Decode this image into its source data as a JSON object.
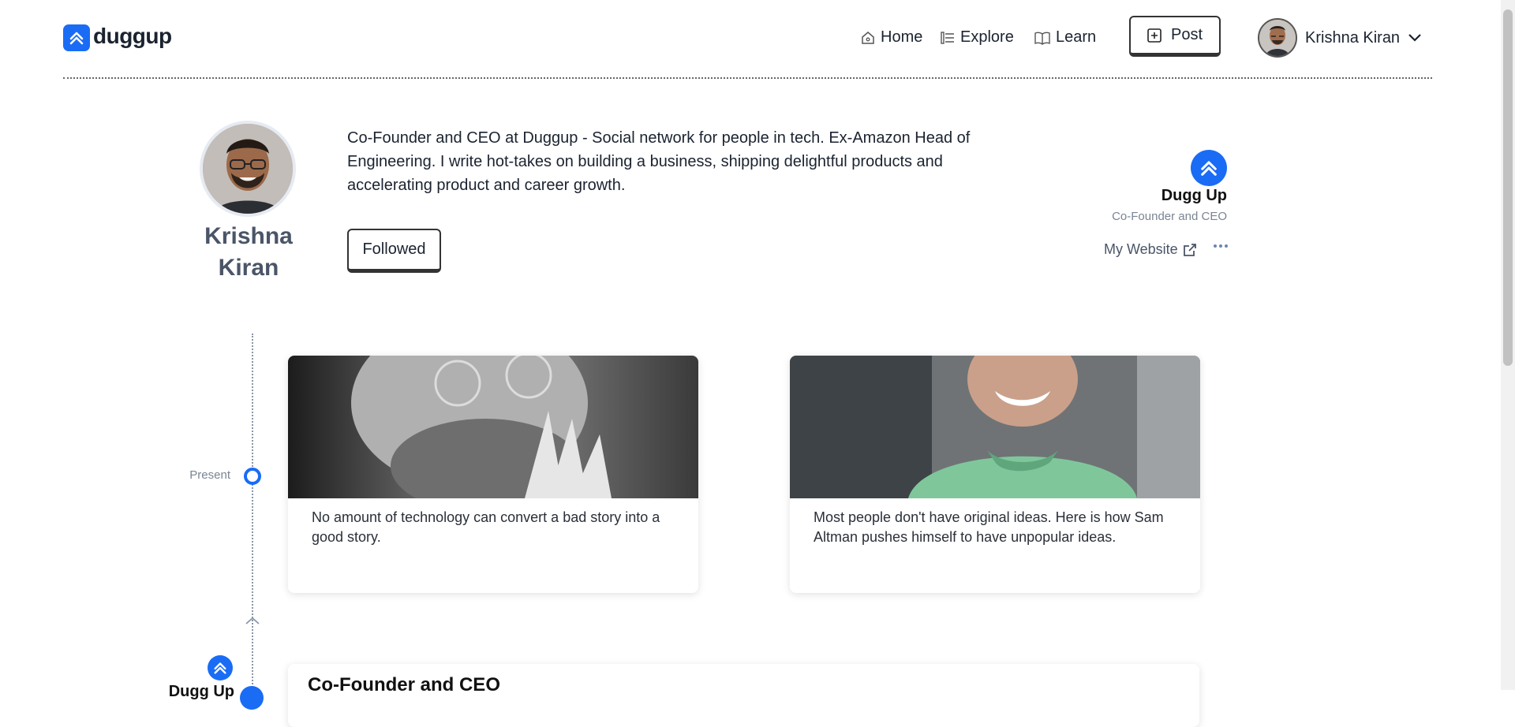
{
  "header": {
    "brand": "duggup",
    "nav": {
      "home": "Home",
      "explore": "Explore",
      "learn": "Learn"
    },
    "post_label": "Post",
    "user_name": "Krishna Kiran"
  },
  "profile": {
    "first_name": "Krishna",
    "last_name": "Kiran",
    "bio": "Co-Founder and CEO at Duggup - Social network for people in tech. Ex-Amazon Head of Engineering. I write hot-takes on building a business, shipping delightful products and accelerating product and career growth.",
    "follow_label": "Followed",
    "company": "Dugg Up",
    "role": "Co-Founder and CEO",
    "website_label": "My Website"
  },
  "timeline": {
    "present_label": "Present",
    "company_label": "Dugg Up"
  },
  "cards": [
    {
      "text": "No amount of technology can convert a bad story into a good story."
    },
    {
      "text": "Most people don't have original ideas. Here is how Sam Altman pushes himself to have unpopular ideas."
    }
  ],
  "experience": {
    "title": "Co-Founder and CEO"
  },
  "colors": {
    "accent": "#1a6cf5",
    "text": "#1b2330",
    "muted": "#7a8594"
  }
}
